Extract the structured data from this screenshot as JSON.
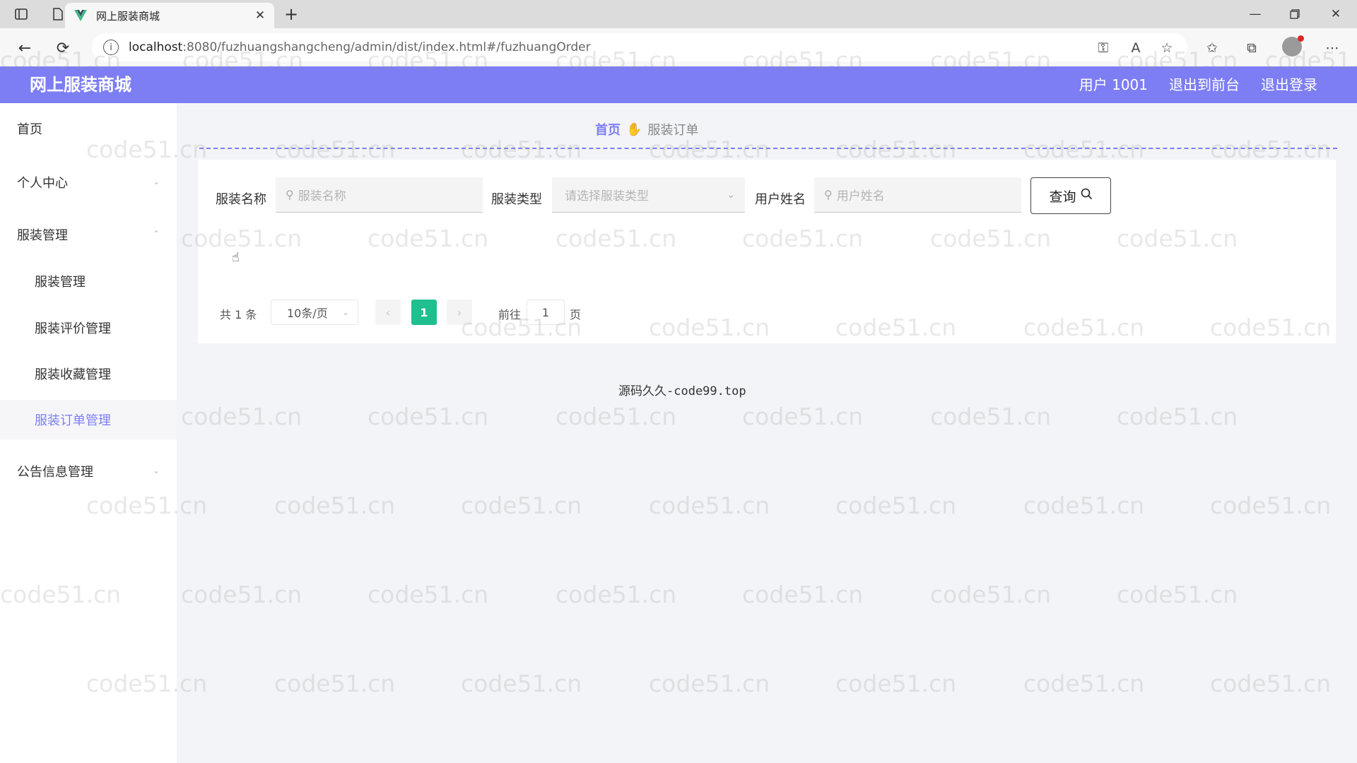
{
  "browser": {
    "tab_title": "网上服装商城",
    "url_host": "localhost",
    "url_rest": ":8080/fuzhuangshangcheng/admin/dist/index.html#/fuzhuangOrder"
  },
  "header": {
    "brand": "网上服装商城",
    "user": "用户 1001",
    "to_front": "退出到前台",
    "logout": "退出登录"
  },
  "sidebar": {
    "items": [
      {
        "label": "首页"
      },
      {
        "label": "个人中心"
      },
      {
        "label": "服装管理"
      },
      {
        "label": "服装管理"
      },
      {
        "label": "服装评价管理"
      },
      {
        "label": "服装收藏管理"
      },
      {
        "label": "服装订单管理"
      },
      {
        "label": "公告信息管理"
      }
    ]
  },
  "breadcrumb": {
    "home": "首页",
    "current": "服装订单"
  },
  "search": {
    "name_label": "服装名称",
    "name_placeholder": "服装名称",
    "type_label": "服装类型",
    "type_placeholder": "请选择服装类型",
    "user_label": "用户姓名",
    "user_placeholder": "用户姓名",
    "query_label": "查询"
  },
  "pagination": {
    "total": "共 1 条",
    "page_size": "10条/页",
    "current_page": "1",
    "goto_label": "前往",
    "goto_value": "1",
    "unit": "页"
  },
  "footer": {
    "text_cjk": "源码久久",
    "text_rest": "-code99.top"
  },
  "watermark": "code51.cn",
  "colors": {
    "accent": "#7d7ef3",
    "page_active": "#1fbf8f"
  }
}
